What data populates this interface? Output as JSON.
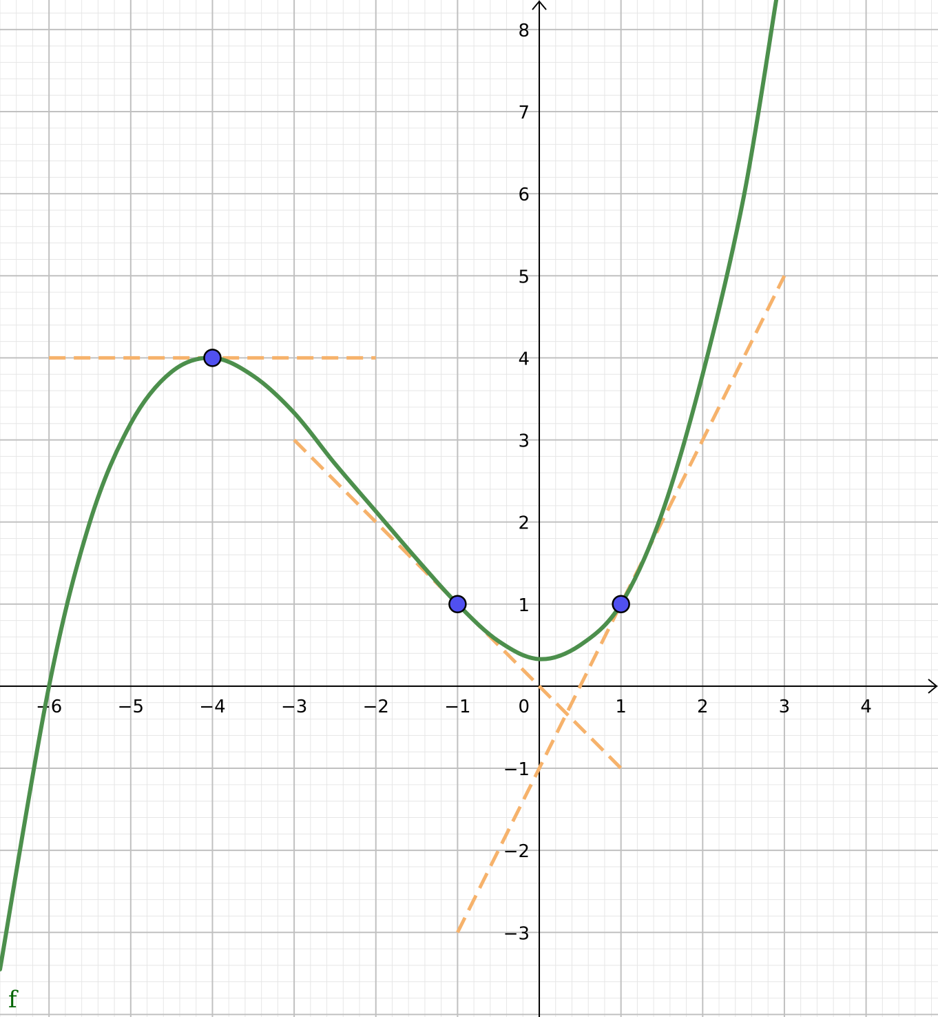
{
  "chart_data": {
    "type": "line",
    "title": "",
    "xlabel": "",
    "ylabel": "",
    "xlim": [
      -6.6,
      4.88
    ],
    "ylim": [
      -4.03,
      8.36
    ],
    "grid": true,
    "minor_grid": true,
    "x_ticks": [
      -6,
      -5,
      -4,
      -3,
      -2,
      -1,
      1,
      2,
      3,
      4
    ],
    "y_ticks": [
      -3,
      -2,
      -1,
      1,
      2,
      3,
      4,
      5,
      6,
      7,
      8
    ],
    "origin_label": "0",
    "function": {
      "name": "f",
      "label": "f",
      "samples": [
        {
          "x": -6.6,
          "y": -3.45
        },
        {
          "x": -6.0,
          "y": 0.0
        },
        {
          "x": -5.5,
          "y": 2.0
        },
        {
          "x": -5.0,
          "y": 3.2
        },
        {
          "x": -4.5,
          "y": 3.83
        },
        {
          "x": -4.0,
          "y": 4.0
        },
        {
          "x": -3.5,
          "y": 3.78
        },
        {
          "x": -3.0,
          "y": 3.33
        },
        {
          "x": -2.5,
          "y": 2.71
        },
        {
          "x": -2.0,
          "y": 2.13
        },
        {
          "x": -1.5,
          "y": 1.55
        },
        {
          "x": -1.0,
          "y": 1.0
        },
        {
          "x": -0.5,
          "y": 0.55
        },
        {
          "x": 0.0,
          "y": 0.33
        },
        {
          "x": 0.5,
          "y": 0.5
        },
        {
          "x": 1.0,
          "y": 1.0
        },
        {
          "x": 1.5,
          "y": 2.1
        },
        {
          "x": 2.0,
          "y": 3.8
        },
        {
          "x": 2.5,
          "y": 5.95
        },
        {
          "x": 2.9,
          "y": 8.36
        }
      ]
    },
    "points": [
      {
        "x": -4,
        "y": 4
      },
      {
        "x": -1,
        "y": 1
      },
      {
        "x": 1,
        "y": 1
      }
    ],
    "tangents": [
      {
        "from": [
          -6,
          4
        ],
        "to": [
          -2,
          4
        ]
      },
      {
        "from": [
          -3,
          3
        ],
        "to": [
          1,
          -1
        ]
      },
      {
        "from": [
          -1,
          -3
        ],
        "to": [
          3,
          5
        ]
      }
    ],
    "colors": {
      "curve": "#4c8f4c",
      "tangent": "#f6b26b",
      "point_fill": "#5050f0",
      "point_stroke": "#000000",
      "major_grid": "#c0c0c0",
      "minor_grid": "#e6e6e6",
      "axis": "#000000",
      "function_label": "#006400"
    }
  }
}
